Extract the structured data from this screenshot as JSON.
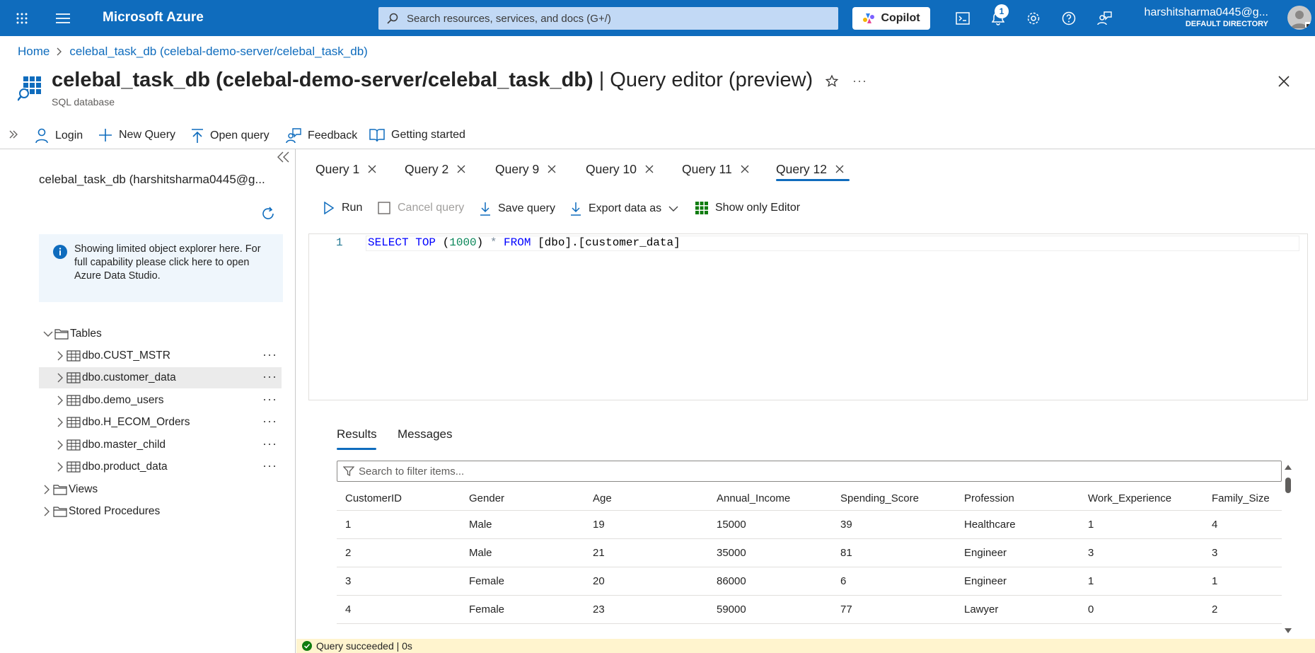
{
  "topbar": {
    "brand": "Microsoft Azure",
    "search_placeholder": "Search resources, services, and docs (G+/)",
    "copilot_label": "Copilot",
    "notification_count": "1",
    "user_email": "harshitsharma0445@g...",
    "user_directory": "DEFAULT DIRECTORY"
  },
  "breadcrumb": {
    "home": "Home",
    "current": "celebal_task_db (celebal-demo-server/celebal_task_db)"
  },
  "header": {
    "title_bold": "celebal_task_db (celebal-demo-server/celebal_task_db)",
    "title_rest": " | Query editor (preview)",
    "subtitle": "SQL database",
    "more": "···"
  },
  "commands": {
    "login": "Login",
    "new_query": "New Query",
    "open_query": "Open query",
    "feedback": "Feedback",
    "getting_started": "Getting started"
  },
  "explorer": {
    "database": "celebal_task_db (harshitsharma0445@g...",
    "info": "Showing limited object explorer here. For full capability please click here to open Azure Data Studio.",
    "tables_label": "Tables",
    "tables": [
      "dbo.CUST_MSTR",
      "dbo.customer_data",
      "dbo.demo_users",
      "dbo.H_ECOM_Orders",
      "dbo.master_child",
      "dbo.product_data"
    ],
    "views_label": "Views",
    "procedures_label": "Stored Procedures",
    "row_more": "···"
  },
  "tabs": [
    "Query 1",
    "Query 2",
    "Query 9",
    "Query 10",
    "Query 11",
    "Query 12"
  ],
  "editor_toolbar": {
    "run": "Run",
    "cancel": "Cancel query",
    "save": "Save query",
    "export": "Export data as",
    "show_only": "Show only Editor"
  },
  "editor": {
    "line_number": "1",
    "kw_select": "SELECT",
    "kw_top": "TOP",
    "paren_open": " (",
    "number": "1000",
    "paren_close": ") ",
    "star": "*",
    "kw_from": " FROM",
    "table": " [dbo].[customer_data]"
  },
  "results": {
    "tab_results": "Results",
    "tab_messages": "Messages",
    "filter_placeholder": "Search to filter items...",
    "columns": [
      "CustomerID",
      "Gender",
      "Age",
      "Annual_Income",
      "Spending_Score",
      "Profession",
      "Work_Experience",
      "Family_Size"
    ],
    "rows": [
      [
        "1",
        "Male",
        "19",
        "15000",
        "39",
        "Healthcare",
        "1",
        "4"
      ],
      [
        "2",
        "Male",
        "21",
        "35000",
        "81",
        "Engineer",
        "3",
        "3"
      ],
      [
        "3",
        "Female",
        "20",
        "86000",
        "6",
        "Engineer",
        "1",
        "1"
      ],
      [
        "4",
        "Female",
        "23",
        "59000",
        "77",
        "Lawyer",
        "0",
        "2"
      ]
    ]
  },
  "status": {
    "text": "Query succeeded | 0s"
  },
  "colors": {
    "azure_blue": "#0f6cbd",
    "success_green": "#107c10",
    "status_bg": "#fff4ce"
  }
}
